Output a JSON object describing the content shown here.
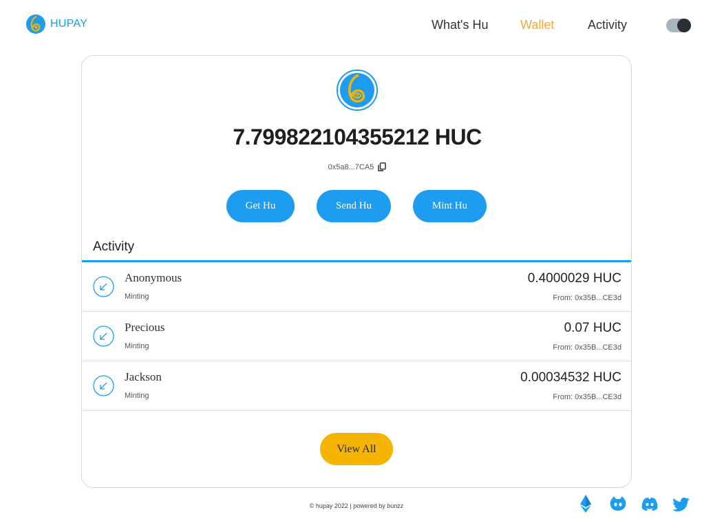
{
  "brand": {
    "name": "HUPAY",
    "accent": "#1d9cf0",
    "logo_icon": "hupay-logo-icon"
  },
  "nav": {
    "items": [
      {
        "label": "What's Hu",
        "active": false
      },
      {
        "label": "Wallet",
        "active": true
      },
      {
        "label": "Activity",
        "active": false
      }
    ],
    "active_color": "#f0a93a"
  },
  "theme_toggle": {
    "state": "dark",
    "icon": "theme-toggle"
  },
  "wallet": {
    "balance": "7.799822104355212 HUC",
    "address": "0x5a8...7CA5",
    "copy_icon": "copy-icon",
    "actions": {
      "get": "Get Hu",
      "send": "Send Hu",
      "mint": "Mint Hu"
    }
  },
  "activity": {
    "title": "Activity",
    "items": [
      {
        "name": "Anonymous",
        "type": "Minting",
        "amount": "0.4000029 HUC",
        "from": "From: 0x35B...CE3d",
        "icon": "incoming-arrow-icon"
      },
      {
        "name": "Precious",
        "type": "Minting",
        "amount": "0.07 HUC",
        "from": "From: 0x35B...CE3d",
        "icon": "incoming-arrow-icon"
      },
      {
        "name": "Jackson",
        "type": "Minting",
        "amount": "0.00034532 HUC",
        "from": "From: 0x35B...CE3d",
        "icon": "incoming-arrow-icon"
      }
    ],
    "view_all": "View All"
  },
  "footer": {
    "text": "© hupay 2022 | powered by bunzz",
    "social": [
      "ethereum-icon",
      "github-icon",
      "discord-icon",
      "twitter-icon"
    ]
  },
  "colors": {
    "primary": "#1d9cf0",
    "secondary": "#f4b400",
    "nav_active": "#f0a93a"
  }
}
